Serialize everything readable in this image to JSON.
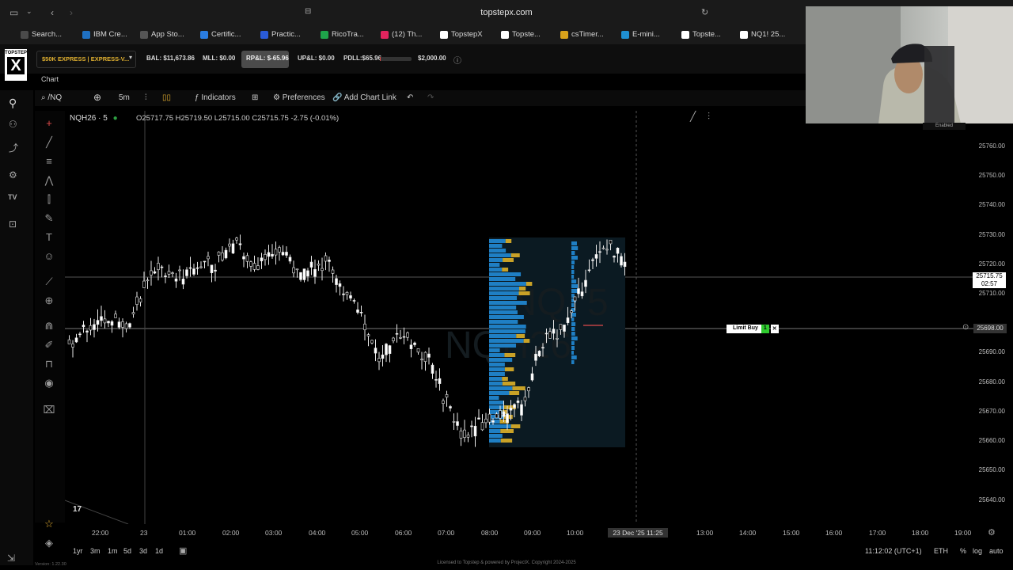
{
  "browser": {
    "url": "topstepx.com",
    "bookmarks": [
      {
        "label": "Search...",
        "color": "#4a4a4a"
      },
      {
        "label": "IBM Cre...",
        "color": "#1f70c1"
      },
      {
        "label": "App Sto...",
        "color": "#555555"
      },
      {
        "label": "Certific...",
        "color": "#2a7de1"
      },
      {
        "label": "Practic...",
        "color": "#2a5bd7"
      },
      {
        "label": "RicoTra...",
        "color": "#1fa34a"
      },
      {
        "label": "(12) Th...",
        "color": "#e0245e"
      },
      {
        "label": "TopstepX",
        "color": "#ffffff"
      },
      {
        "label": "Topste...",
        "color": "#ffffff"
      },
      {
        "label": "csTimer...",
        "color": "#d8a21b"
      },
      {
        "label": "E-mini...",
        "color": "#1f8fd1"
      },
      {
        "label": "Topste...",
        "color": "#ffffff"
      },
      {
        "label": "NQ1! 25...",
        "color": "#ffffff"
      }
    ]
  },
  "header": {
    "logo_top": "TOPSTEP",
    "logo_mark": "X",
    "account": "$50K EXPRESS | EXPRESS-V...",
    "bal": "BAL: $11,673.86",
    "mll": "MLL: $0.00",
    "rpl": "RP&L: $-65.96",
    "upl": "UP&L: $0.00",
    "pdll": "PDLL:$65.96",
    "pdll_limit": "$2,000.00",
    "pdll_fill": 0.033
  },
  "chart_tab": "Chart",
  "toolbar": {
    "symbol_search": "/NQ",
    "interval": "5m",
    "indicators": "Indicators",
    "preferences": "Preferences",
    "add_chart_link": "Add Chart Link"
  },
  "chart": {
    "symbol": "NQH26 · 5",
    "ohlc": "O25717.75 H25719.50 L25715.00 C25715.75 -2.75 (-0.01%)",
    "watermark_line1": "/NQ, 5",
    "watermark_line2": "NQH26",
    "price_ticks": [
      "25760.00",
      "25750.00",
      "25740.00",
      "25730.00",
      "25720.00",
      "25710.00",
      "25690.00",
      "25680.00",
      "25670.00",
      "25660.00",
      "25650.00",
      "25640.00"
    ],
    "current_price": "25715.75",
    "countdown": "02:57",
    "crosshair_price": "25698.00",
    "time_ticks": [
      "22:00",
      "23",
      "01:00",
      "02:00",
      "03:00",
      "04:00",
      "05:00",
      "06:00",
      "07:00",
      "08:00",
      "09:00",
      "10:00",
      "13:00",
      "14:00",
      "15:00",
      "16:00",
      "17:00",
      "18:00",
      "19:00"
    ],
    "crosshair_time": "23 Dec '25  11:25",
    "limit_order_label": "Limit Buy",
    "limit_order_qty": "1",
    "accent_up": "#ffffff",
    "profile_blue": "#1f7fc4",
    "profile_gold": "#c9a227"
  },
  "bottom": {
    "ranges": [
      "1yr",
      "3m",
      "1m",
      "5d",
      "3d",
      "1d"
    ],
    "clock": "11:12:02 (UTC+1)",
    "session": "ETH",
    "percent": "%",
    "log": "log",
    "auto": "auto",
    "version": "Version: 1.22.30",
    "footer": "Licensed to Topstep & powered by ProjectX. Copyright 2024-2025"
  },
  "webcam": {
    "status": "Enabled"
  }
}
